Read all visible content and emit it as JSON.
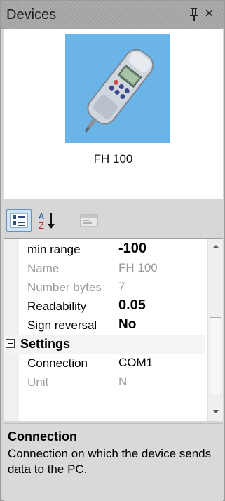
{
  "window": {
    "title": "Devices",
    "pin_icon": "pin-icon",
    "close_glyph": "×"
  },
  "device": {
    "name": "FH 100",
    "image": "force-gauge-device-image"
  },
  "toolbar": {
    "categorized_icon": "categorized-view-icon",
    "alphabetical_icon": "sort-az-icon",
    "property_pages_icon": "property-pages-icon"
  },
  "properties": {
    "rows": [
      {
        "label": "min range",
        "value": "-100",
        "readonly": false,
        "bold": true
      },
      {
        "label": "Name",
        "value": "FH 100",
        "readonly": true,
        "bold": false
      },
      {
        "label": "Number bytes",
        "value": "7",
        "readonly": true,
        "bold": false
      },
      {
        "label": "Readability",
        "value": "0.05",
        "readonly": false,
        "bold": true
      },
      {
        "label": "Sign reversal",
        "value": "No",
        "readonly": false,
        "bold": true
      }
    ],
    "category": {
      "label": "Settings",
      "expander": "−",
      "expanded": true
    },
    "settings_rows": [
      {
        "label": "Connection",
        "value": "COM1",
        "readonly": false,
        "bold": false
      },
      {
        "label": "Unit",
        "value": "N",
        "readonly": true,
        "bold": false
      }
    ]
  },
  "description": {
    "title": "Connection",
    "text": "Connection on which the device sends data to the PC."
  },
  "colors": {
    "device_bg": "#6ab4e7",
    "titlebar": "#a8a8a8",
    "readonly_text": "#9a9a9a"
  }
}
